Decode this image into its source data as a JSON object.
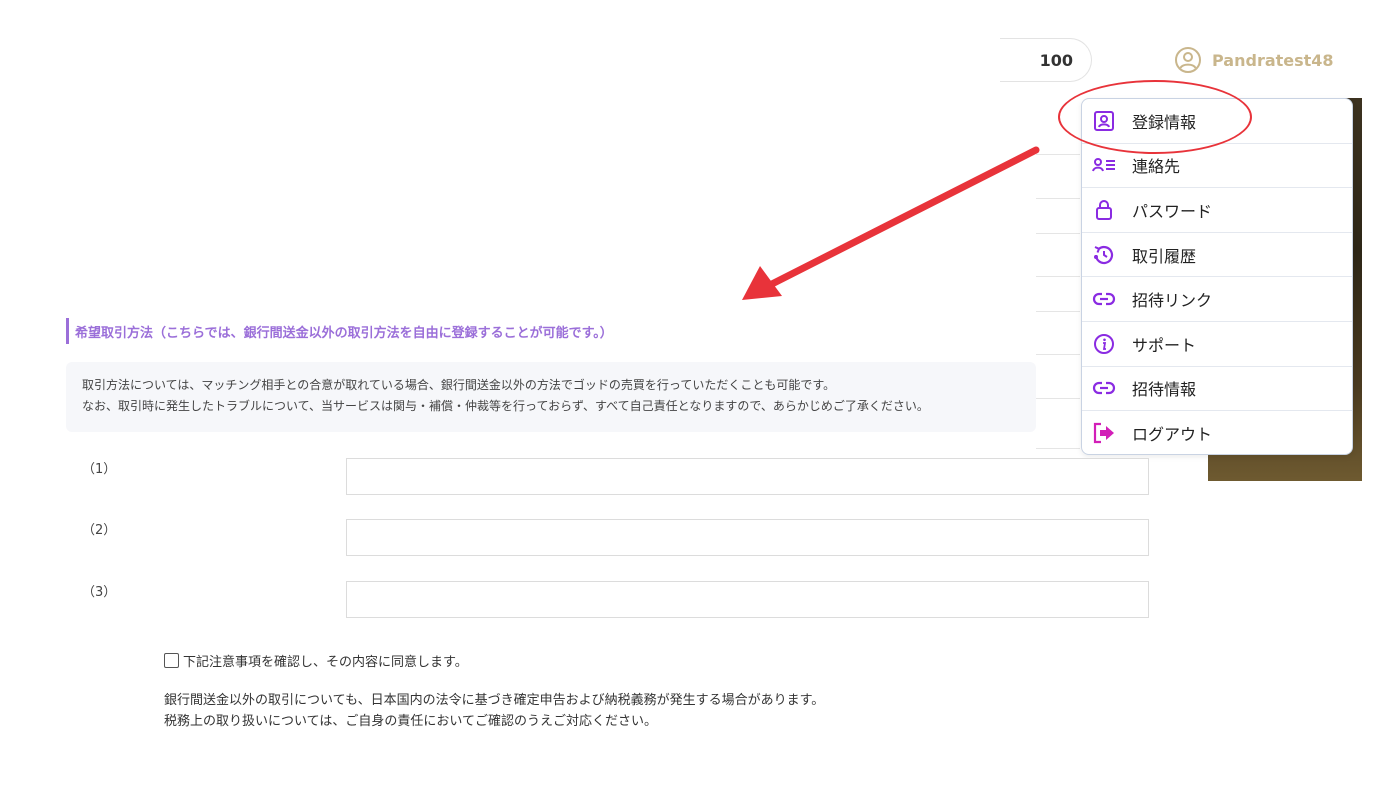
{
  "header": {
    "balance": "100",
    "username": "Pandratest48"
  },
  "menu": {
    "items": [
      {
        "label": "登録情報",
        "icon": "user-card-icon"
      },
      {
        "label": "連絡先",
        "icon": "contact-list-icon"
      },
      {
        "label": "パスワード",
        "icon": "lock-icon"
      },
      {
        "label": "取引履歴",
        "icon": "history-icon"
      },
      {
        "label": "招待リンク",
        "icon": "link-icon"
      },
      {
        "label": "サポート",
        "icon": "info-icon"
      },
      {
        "label": "招待情報",
        "icon": "link-icon"
      },
      {
        "label": "ログアウト",
        "icon": "logout-icon"
      }
    ]
  },
  "form": {
    "section_title": "希望取引方法（こちらでは、銀行間送金以外の取引方法を自由に登録することが可能です。）",
    "notice_line1": "取引方法については、マッチング相手との合意が取れている場合、銀行間送金以外の方法でゴッドの売買を行っていただくことも可能です。",
    "notice_line2": "なお、取引時に発生したトラブルについて、当サービスは関与・補償・仲裁等を行っておらず、すべて自己責任となりますので、あらかじめご了承ください。",
    "rows": [
      {
        "label": "（1）",
        "value": ""
      },
      {
        "label": "（2）",
        "value": ""
      },
      {
        "label": "（3）",
        "value": ""
      }
    ],
    "agree_label": "下記注意事項を確認し、その内容に同意します。",
    "tax_line1": "銀行間送金以外の取引についても、日本国内の法令に基づき確定申告および納税義務が発生する場合があります。",
    "tax_line2": "税務上の取り扱いについては、ご自身の責任においてご確認のうえご対応ください。"
  },
  "colors": {
    "accent": "#9b6fd9",
    "icon": "#8a2be2",
    "username": "#c9b68c",
    "annotation": "#e8333a"
  }
}
